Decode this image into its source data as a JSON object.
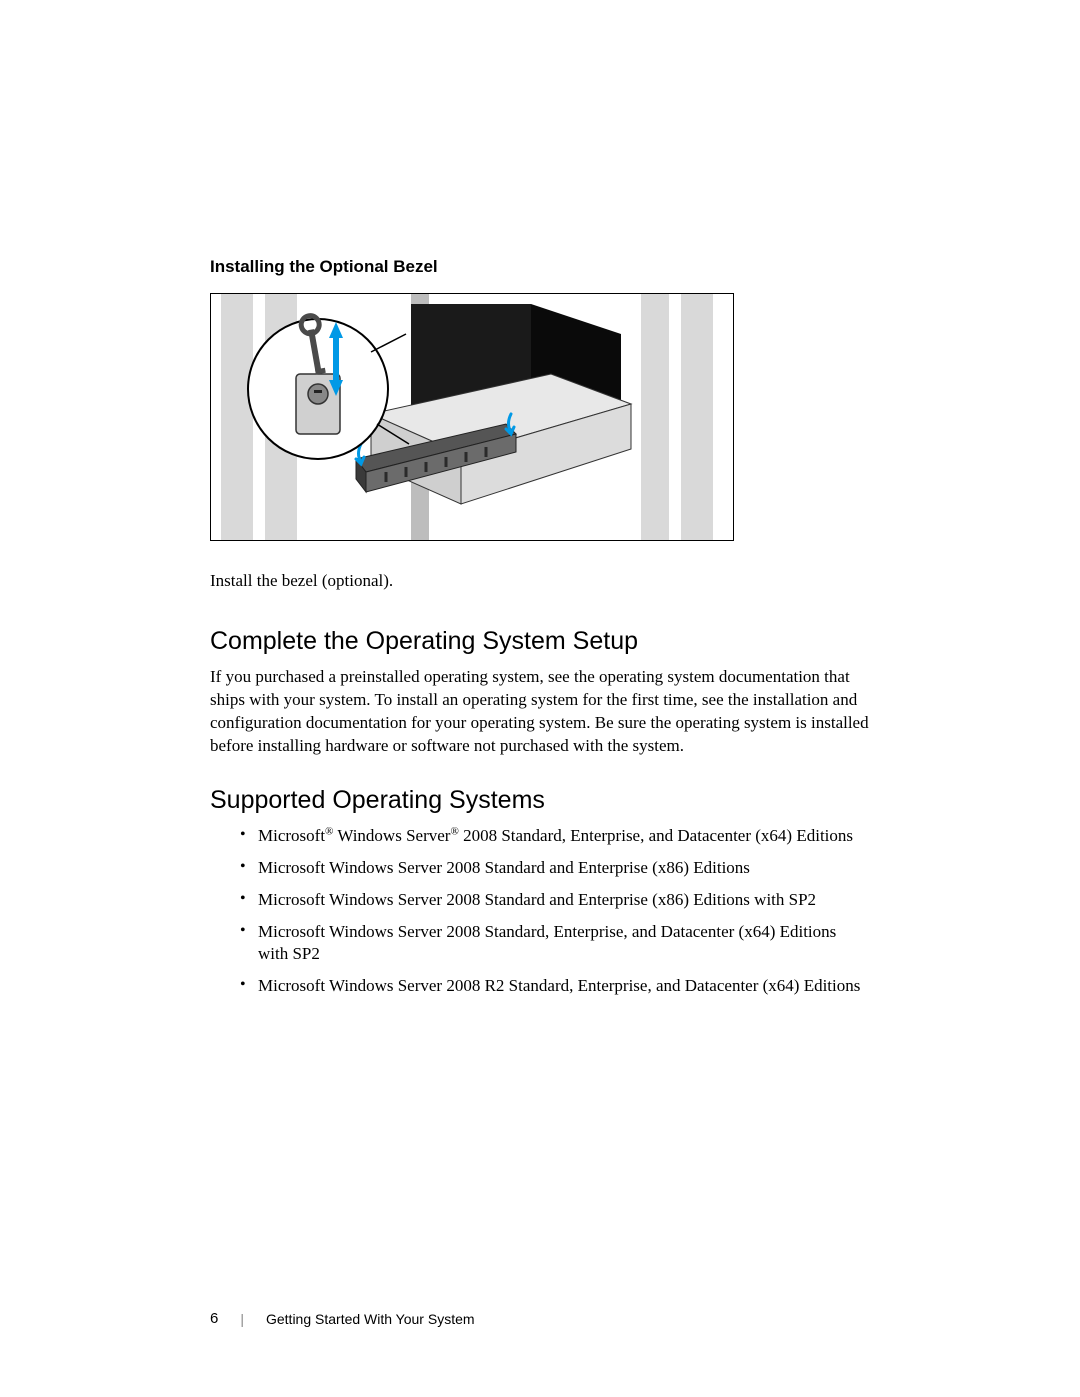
{
  "subsection_heading": "Installing the Optional Bezel",
  "caption": "Install the bezel (optional).",
  "section1_heading": "Complete the Operating System Setup",
  "section1_body": "If you purchased a preinstalled operating system, see the operating system documentation that ships with your system. To install an operating system for the first time, see the installation and configuration documentation for your operating system. Be sure the operating system is installed before installing hardware or software not purchased with the system.",
  "section2_heading": "Supported Operating Systems",
  "os_items": {
    "0": {
      "pre": "Microsoft",
      "mid": " Windows Server",
      "post": " 2008 Standard, Enterprise, and Datacenter (x64) Editions",
      "has_reg": true
    },
    "1": {
      "text": "Microsoft Windows Server 2008 Standard and Enterprise (x86) Editions"
    },
    "2": {
      "text": "Microsoft Windows Server 2008 Standard and Enterprise (x86) Editions with SP2"
    },
    "3": {
      "text": "Microsoft Windows Server 2008 Standard, Enterprise, and Datacenter (x64) Editions with SP2"
    },
    "4": {
      "text": "Microsoft Windows Server 2008 R2 Standard, Enterprise, and Datacenter (x64) Editions"
    }
  },
  "footer": {
    "page_number": "6",
    "title": "Getting Started With Your System"
  },
  "reg_symbol": "®"
}
